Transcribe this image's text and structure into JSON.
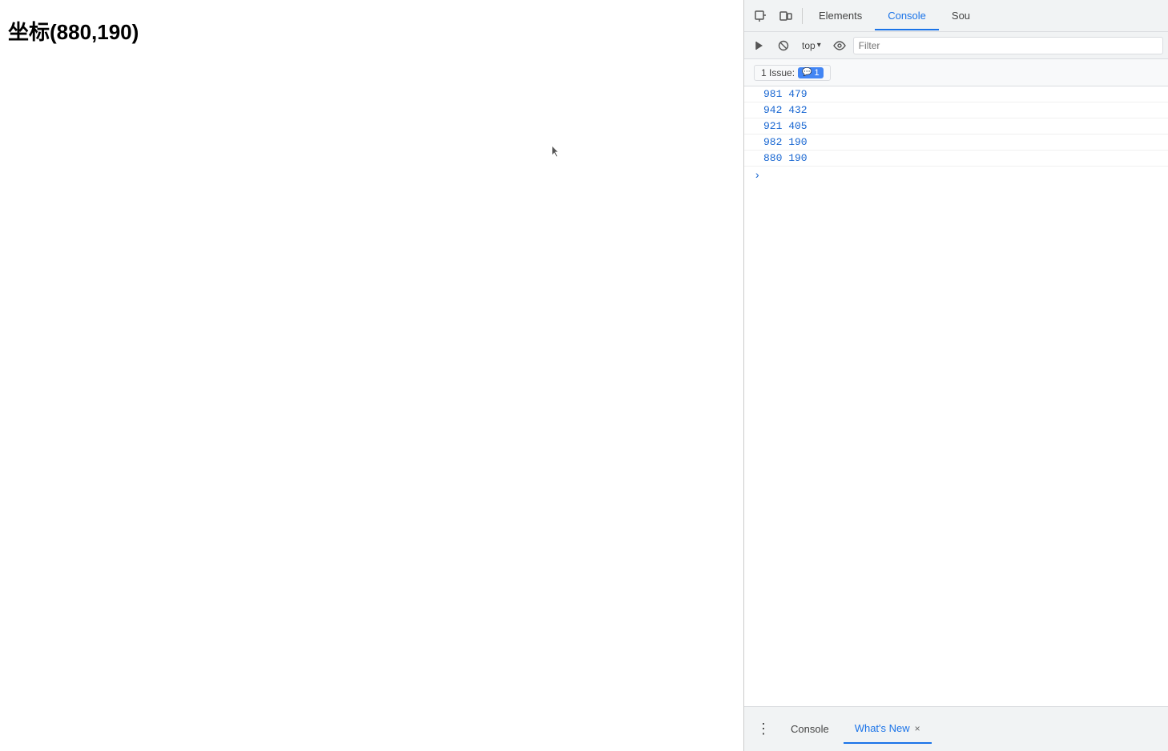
{
  "page": {
    "coordinate_label": "坐标(880,190)"
  },
  "devtools": {
    "tabs": [
      {
        "label": "Elements",
        "active": false
      },
      {
        "label": "Console",
        "active": true
      },
      {
        "label": "Sou",
        "active": false,
        "partial": true
      }
    ],
    "toolbar": {
      "run_snippet_tooltip": "Run snippet",
      "clear_console_tooltip": "Clear console",
      "context_label": "top",
      "eye_tooltip": "Live expressions",
      "filter_placeholder": "Filter"
    },
    "issues": {
      "label": "1 Issue:",
      "count": "1"
    },
    "console_entries": [
      {
        "value": "981  479"
      },
      {
        "value": "942  432"
      },
      {
        "value": "921  405"
      },
      {
        "value": "982  190"
      },
      {
        "value": "880  190"
      }
    ],
    "bottom_bar": {
      "console_label": "Console",
      "whats_new_label": "What's New",
      "close_label": "×"
    }
  }
}
